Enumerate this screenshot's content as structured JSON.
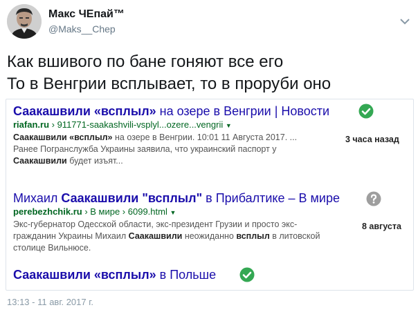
{
  "author": {
    "name": "Макс ЧЕпай™",
    "handle": "@Maks__Chep"
  },
  "tweet": {
    "line1": "Как вшивого по бане гоняют все его",
    "line2": "То в Венгрии всплывает, то в проруби оно",
    "timestamp": "13:13 - 11 авг. 2017 г."
  },
  "results": [
    {
      "title_bold1": "Саакашвили «всплыл»",
      "title_rest": " на озере в Венгрии | Новости",
      "url_bold": "riafan.ru",
      "url_rest": " › 911771-saakashvili-vsplyl...ozere...vengrii",
      "snippet_bold": "Саакашвили «всплыл»",
      "snippet_rest1": " на озере в Венгрии. 10:01 11 Августа 2017. ...",
      "snippet_line2": "Ранее Погранслужба Украины заявила, что украинский паспорт у",
      "snippet_bold3": "Саакашвили",
      "snippet_rest3": " будет изъят...",
      "date": "3 часа назад",
      "badge": "check-icon"
    },
    {
      "title_pre": "Михаил ",
      "title_bold1": "Саакашвили \"всплыл\"",
      "title_rest": " в Прибалтике – В мире",
      "url_bold": "perebezhchik.ru",
      "url_rest": " › В мире › 6099.html",
      "snippet_line1": "Экс-губернатор Одесской области, экс-президент Грузии и просто экс-",
      "snippet_pre2": "гражданин Украины Михаил ",
      "snippet_bold2a": "Саакашвили",
      "snippet_mid2": " неожиданно ",
      "snippet_bold2b": "всплыл",
      "snippet_rest2": " в литовской",
      "snippet_line3": "столице Вильнюсе.",
      "date": "8 августа",
      "badge": "question-icon"
    },
    {
      "title_bold1": "Саакашвили «всплыл»",
      "title_rest": " в Польше",
      "badge": "check-icon"
    }
  ],
  "colors": {
    "link": "#1a0dab",
    "url": "#006621",
    "check": "#34a853",
    "question": "#9e9e9e"
  }
}
